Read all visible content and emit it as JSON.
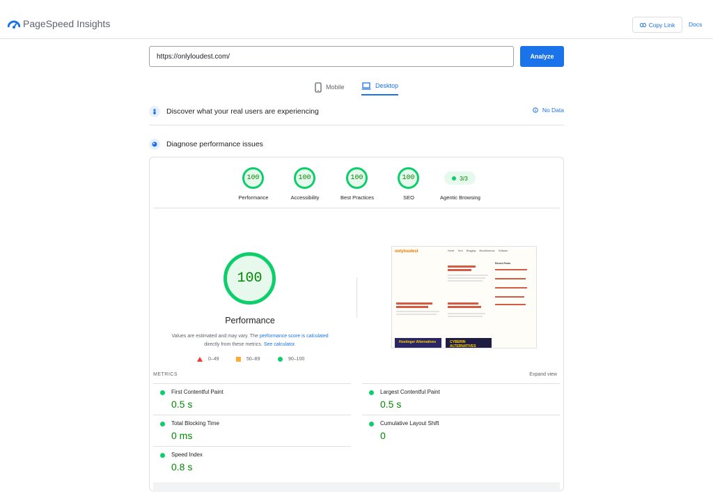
{
  "header": {
    "brand": "PageSpeed Insights",
    "copy_link": "Copy Link",
    "docs": "Docs",
    "logo_icon": "pagespeed-logo-icon"
  },
  "search": {
    "url": "https://onlyloudest.com/",
    "analyze": "Analyze"
  },
  "tabs": [
    {
      "label": "Mobile",
      "icon": "phone-icon",
      "active": false
    },
    {
      "label": "Desktop",
      "icon": "laptop-icon",
      "active": true
    }
  ],
  "crux": {
    "title": "Discover what your real users are experiencing",
    "status": "No Data",
    "status_icon": "info-icon"
  },
  "diagnose": {
    "title": "Diagnose performance issues"
  },
  "scores": [
    {
      "label": "Performance",
      "value": "100"
    },
    {
      "label": "Accessibility",
      "value": "100"
    },
    {
      "label": "Best Practices",
      "value": "100"
    },
    {
      "label": "SEO",
      "value": "100"
    },
    {
      "label": "Agentic Browsing",
      "value": "3/3"
    }
  ],
  "performance": {
    "score": "100",
    "label": "Performance",
    "note_prefix": "Values are estimated and may vary. The ",
    "note_link": "performance score is calculated",
    "note_mid": " directly from these metrics. ",
    "note_link2": "See calculator",
    "note_end": "."
  },
  "legend": [
    {
      "range": "0–49",
      "color": "#ff3333"
    },
    {
      "range": "50–89",
      "color": "#ffaa33"
    },
    {
      "range": "90–100",
      "color": "#0cce6b"
    }
  ],
  "screenshot": {
    "logo": "onlyloudest",
    "nav": [
      "Home",
      "Tech",
      "Blogging",
      "Miscellaneous",
      "Software"
    ],
    "sidebar_title": "Recent Posts",
    "ad1": "Hostinger Alternatives",
    "ad2": "CYBERIN ALTERNATIVES"
  },
  "metrics": {
    "heading": "METRICS",
    "expand": "Expand view",
    "items": [
      {
        "name": "First Contentful Paint",
        "value": "0.5 s"
      },
      {
        "name": "Largest Contentful Paint",
        "value": "0.5 s"
      },
      {
        "name": "Total Blocking Time",
        "value": "0 ms"
      },
      {
        "name": "Cumulative Layout Shift",
        "value": "0"
      },
      {
        "name": "Speed Index",
        "value": "0.8 s"
      }
    ]
  },
  "colors": {
    "accent": "#1a73e8",
    "pass": "#0cce6b",
    "pass_text": "#008800"
  }
}
